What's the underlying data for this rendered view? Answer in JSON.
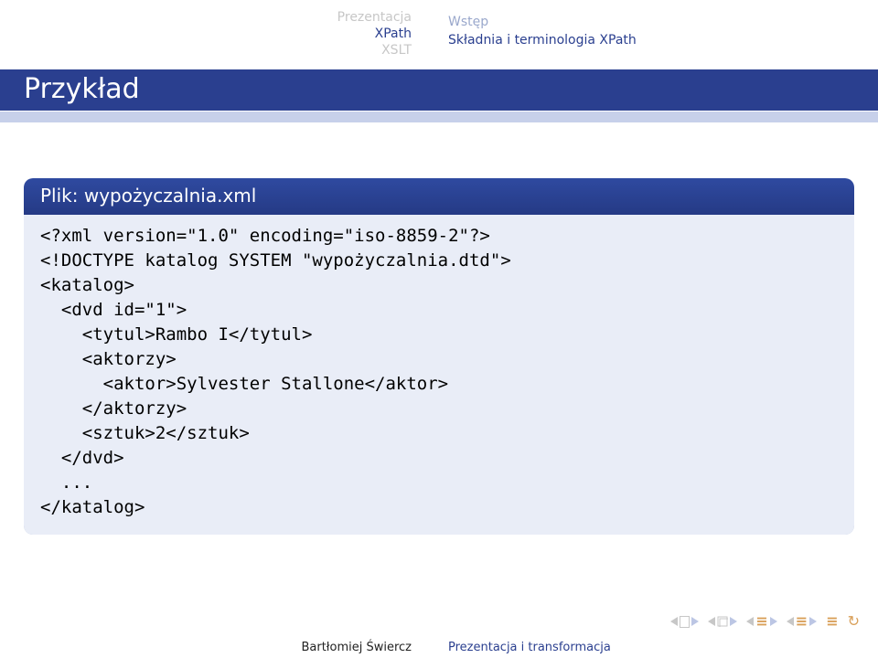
{
  "header": {
    "sections": {
      "s1": "Prezentacja",
      "s2": "XPath",
      "s3": "XSLT"
    },
    "subsections": {
      "s1": "Wstęp",
      "s2": "Składnia i terminologia XPath"
    }
  },
  "title": "Przykład",
  "example": {
    "caption": "Plik: wypożyczalnia.xml",
    "code": "<?xml version=\"1.0\" encoding=\"iso-8859-2\"?>\n<!DOCTYPE katalog SYSTEM \"wypożyczalnia.dtd\">\n<katalog>\n  <dvd id=\"1\">\n    <tytul>Rambo I</tytul>\n    <aktorzy>\n      <aktor>Sylvester Stallone</aktor>\n    </aktorzy>\n    <sztuk>2</sztuk>\n  </dvd>\n  ...\n</katalog>"
  },
  "footer": {
    "author": "Bartłomiej Świercz",
    "title": "Prezentacja i transformacja"
  }
}
